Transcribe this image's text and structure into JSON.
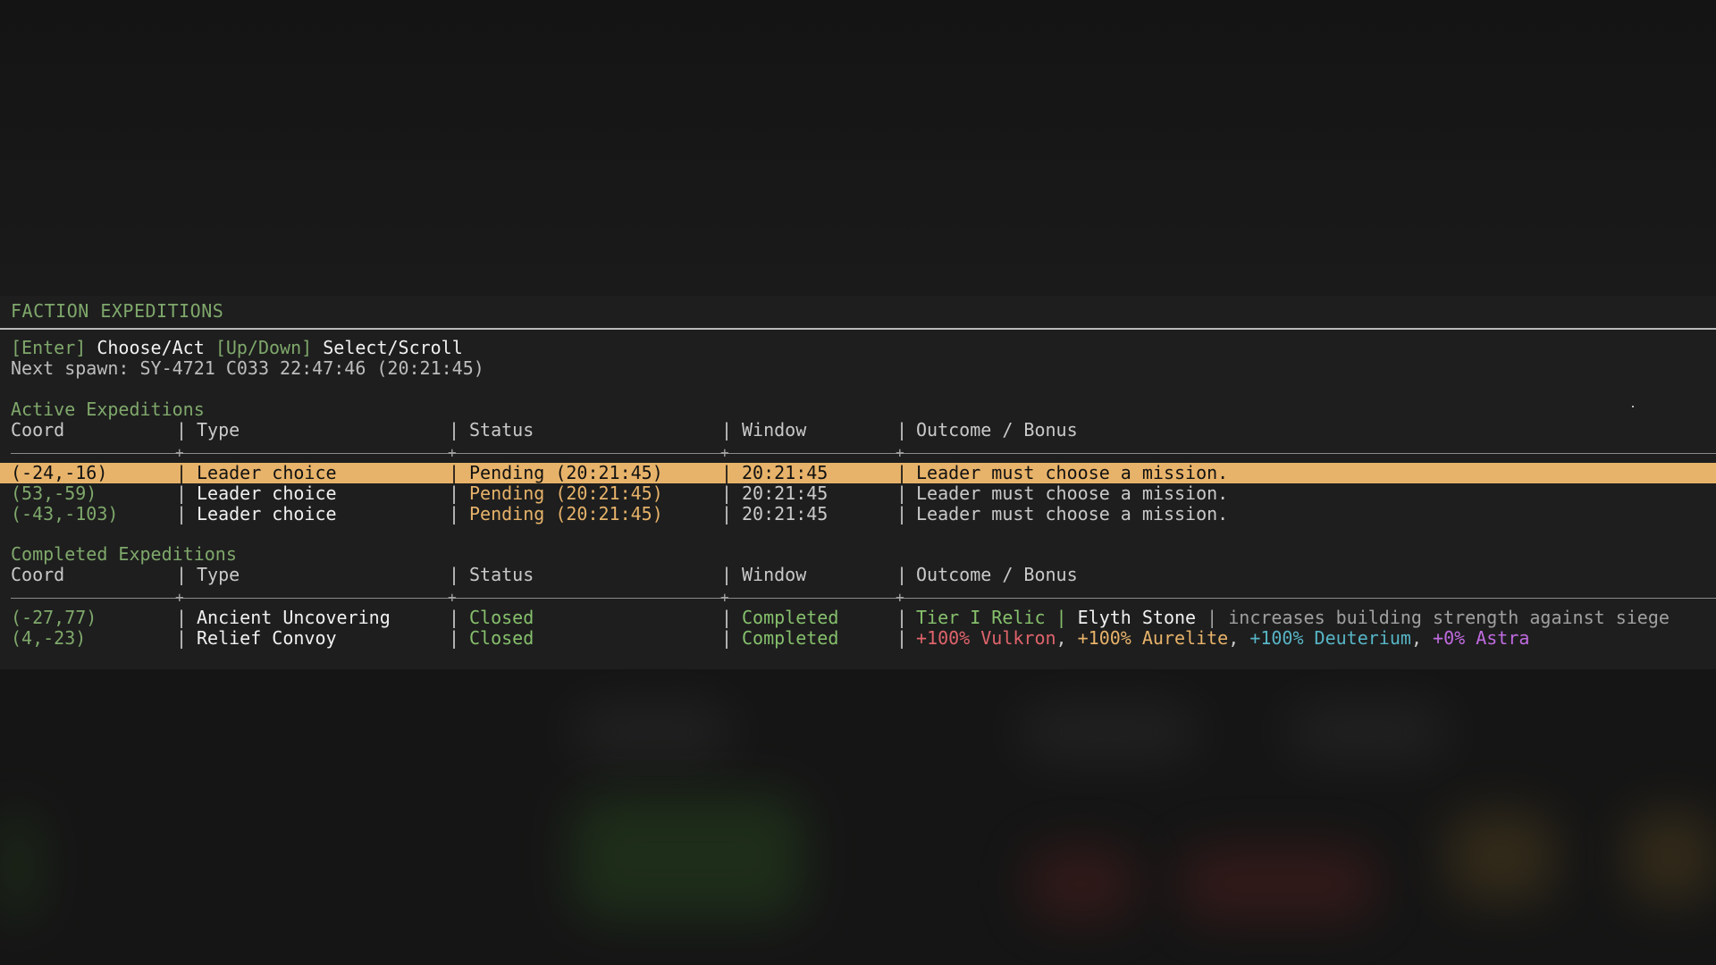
{
  "panel": {
    "title": "FACTION EXPEDITIONS",
    "controls": {
      "enter_key": "[Enter]",
      "enter_label": "Choose/Act",
      "updown_key": "[Up/Down]",
      "updown_label": "Select/Scroll"
    },
    "next_spawn": "Next spawn: SY-4721 C033 22:47:46 (20:21:45)"
  },
  "columns": {
    "coord": "Coord",
    "type": "Type",
    "status": "Status",
    "window": "Window",
    "outcome": "Outcome / Bonus"
  },
  "active": {
    "title": "Active Expeditions",
    "rows": [
      {
        "coord": "(-24,-16)",
        "type": "Leader choice",
        "status": "Pending (20:21:45)",
        "window": "20:21:45",
        "outcome": "Leader must choose a mission.",
        "selected": true
      },
      {
        "coord": "(53,-59)",
        "type": "Leader choice",
        "status": "Pending (20:21:45)",
        "window": "20:21:45",
        "outcome": "Leader must choose a mission."
      },
      {
        "coord": "(-43,-103)",
        "type": "Leader choice",
        "status": "Pending (20:21:45)",
        "window": "20:21:45",
        "outcome": "Leader must choose a mission."
      }
    ]
  },
  "completed": {
    "title": "Completed Expeditions",
    "rows": [
      {
        "coord": "(-27,77)",
        "type": "Ancient Uncovering",
        "status": "Closed",
        "window": "Completed",
        "outcome": {
          "tier": "Tier I Relic",
          "bar": "|",
          "item": "Elyth Stone",
          "bar2": "|",
          "desc": "increases building strength against siege"
        }
      },
      {
        "coord": "(4,-23)",
        "type": "Relief Convoy",
        "status": "Closed",
        "window": "Completed",
        "outcome": {
          "vulkron": "+100% Vulkron",
          "comma1": ",",
          "aurelite": "+100% Aurelite",
          "comma2": ",",
          "deuterium": "+100% Deuterium",
          "comma3": ",",
          "astra": "+0% Astra"
        }
      }
    ]
  },
  "colors": {
    "accent_green": "#7fa86b",
    "selection": "#e7b36a",
    "vulkron": "#e0646b",
    "aurelite": "#e7b36a",
    "deuterium": "#57b5c6",
    "astra": "#c06be0"
  }
}
